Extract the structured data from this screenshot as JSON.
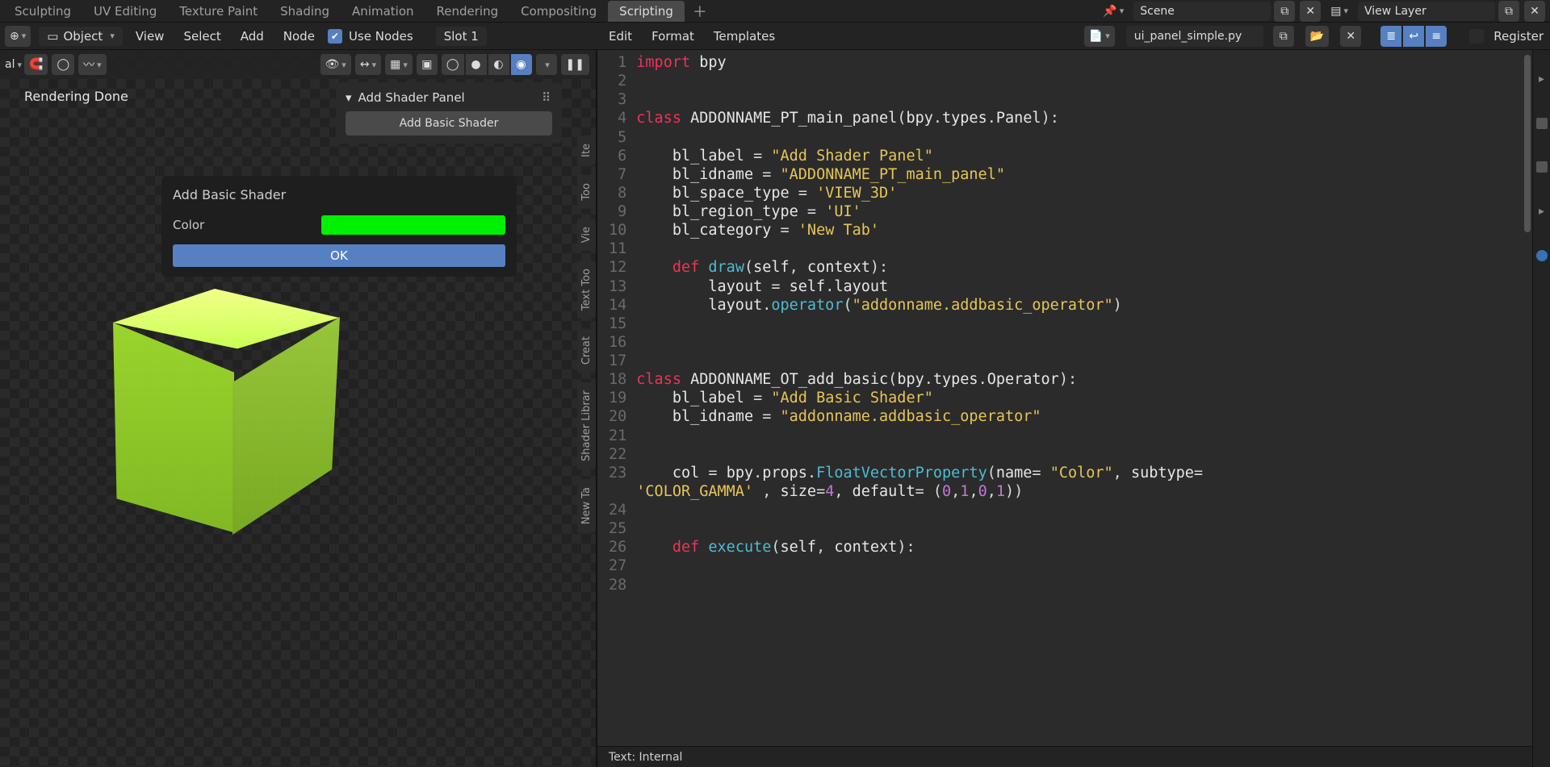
{
  "workspace_tabs": [
    "Sculpting",
    "UV Editing",
    "Texture Paint",
    "Shading",
    "Animation",
    "Rendering",
    "Compositing",
    "Scripting"
  ],
  "workspace_active": "Scripting",
  "scene_field": "Scene",
  "viewlayer_field": "View Layer",
  "node_header": {
    "mode_label": "Object",
    "menus": [
      "View",
      "Select",
      "Add",
      "Node"
    ],
    "use_nodes_label": "Use Nodes",
    "use_nodes_checked": true,
    "slot_label": "Slot 1"
  },
  "render_status": "Rendering Done",
  "side_tabs": [
    "Ite",
    "Too",
    "Vie",
    "Text Too",
    "Creat",
    "Shader Librar",
    "New Ta"
  ],
  "npanel": {
    "title": "Add Shader Panel",
    "button": "Add Basic Shader"
  },
  "op_popup": {
    "title": "Add Basic Shader",
    "color_label": "Color",
    "color_value": "#00f000",
    "ok_label": "OK"
  },
  "text_header": {
    "menus": [
      "Edit",
      "Format",
      "Templates"
    ],
    "filename": "ui_panel_simple.py",
    "register_label": "Register",
    "register_checked": false,
    "line_numbers_on": true,
    "wrap_on": true,
    "syntax_on": true
  },
  "code_lines": [
    {
      "n": 1,
      "t": [
        [
          "kw",
          "import"
        ],
        [
          "pn",
          " "
        ],
        [
          "var",
          "bpy"
        ]
      ]
    },
    {
      "n": 2,
      "t": []
    },
    {
      "n": 3,
      "t": []
    },
    {
      "n": 4,
      "t": [
        [
          "kw",
          "class"
        ],
        [
          "pn",
          " "
        ],
        [
          "var",
          "ADDONNAME_PT_main_panel"
        ],
        [
          "pn",
          "("
        ],
        [
          "var",
          "bpy"
        ],
        [
          "pn",
          "."
        ],
        [
          "var",
          "types"
        ],
        [
          "pn",
          "."
        ],
        [
          "var",
          "Panel"
        ],
        [
          "pn",
          "):"
        ]
      ]
    },
    {
      "n": 5,
      "t": []
    },
    {
      "n": 6,
      "t": [
        [
          "pn",
          "    "
        ],
        [
          "var",
          "bl_label"
        ],
        [
          "pn",
          " = "
        ],
        [
          "str",
          "\"Add Shader Panel\""
        ]
      ]
    },
    {
      "n": 7,
      "t": [
        [
          "pn",
          "    "
        ],
        [
          "var",
          "bl_idname"
        ],
        [
          "pn",
          " = "
        ],
        [
          "str",
          "\"ADDONNAME_PT_main_panel\""
        ]
      ]
    },
    {
      "n": 8,
      "t": [
        [
          "pn",
          "    "
        ],
        [
          "var",
          "bl_space_type"
        ],
        [
          "pn",
          " = "
        ],
        [
          "str",
          "'VIEW_3D'"
        ]
      ]
    },
    {
      "n": 9,
      "t": [
        [
          "pn",
          "    "
        ],
        [
          "var",
          "bl_region_type"
        ],
        [
          "pn",
          " = "
        ],
        [
          "str",
          "'UI'"
        ]
      ]
    },
    {
      "n": 10,
      "t": [
        [
          "pn",
          "    "
        ],
        [
          "var",
          "bl_category"
        ],
        [
          "pn",
          " = "
        ],
        [
          "str",
          "'New Tab'"
        ]
      ]
    },
    {
      "n": 11,
      "t": []
    },
    {
      "n": 12,
      "t": [
        [
          "pn",
          "    "
        ],
        [
          "kw",
          "def"
        ],
        [
          "pn",
          " "
        ],
        [
          "fn",
          "draw"
        ],
        [
          "pn",
          "("
        ],
        [
          "var",
          "self"
        ],
        [
          "pn",
          ", "
        ],
        [
          "var",
          "context"
        ],
        [
          "pn",
          "):"
        ]
      ]
    },
    {
      "n": 13,
      "t": [
        [
          "pn",
          "        "
        ],
        [
          "var",
          "layout"
        ],
        [
          "pn",
          " = "
        ],
        [
          "var",
          "self"
        ],
        [
          "pn",
          "."
        ],
        [
          "var",
          "layout"
        ]
      ]
    },
    {
      "n": 14,
      "t": [
        [
          "pn",
          "        "
        ],
        [
          "var",
          "layout"
        ],
        [
          "pn",
          "."
        ],
        [
          "fn",
          "operator"
        ],
        [
          "pn",
          "("
        ],
        [
          "str",
          "\"addonname.addbasic_operator\""
        ],
        [
          "pn",
          ")"
        ]
      ]
    },
    {
      "n": 15,
      "t": []
    },
    {
      "n": 16,
      "t": []
    },
    {
      "n": 17,
      "t": []
    },
    {
      "n": 18,
      "t": [
        [
          "kw",
          "class"
        ],
        [
          "pn",
          " "
        ],
        [
          "var",
          "ADDONNAME_OT_add_basic"
        ],
        [
          "pn",
          "("
        ],
        [
          "var",
          "bpy"
        ],
        [
          "pn",
          "."
        ],
        [
          "var",
          "types"
        ],
        [
          "pn",
          "."
        ],
        [
          "var",
          "Operator"
        ],
        [
          "pn",
          "):"
        ]
      ]
    },
    {
      "n": 19,
      "t": [
        [
          "pn",
          "    "
        ],
        [
          "var",
          "bl_label"
        ],
        [
          "pn",
          " = "
        ],
        [
          "str",
          "\"Add Basic Shader\""
        ]
      ]
    },
    {
      "n": 20,
      "t": [
        [
          "pn",
          "    "
        ],
        [
          "var",
          "bl_idname"
        ],
        [
          "pn",
          " = "
        ],
        [
          "str",
          "\"addonname.addbasic_operator\""
        ]
      ]
    },
    {
      "n": 21,
      "t": []
    },
    {
      "n": 22,
      "t": []
    },
    {
      "n": 23,
      "t": [
        [
          "pn",
          "    "
        ],
        [
          "var",
          "col"
        ],
        [
          "pn",
          " = "
        ],
        [
          "var",
          "bpy"
        ],
        [
          "pn",
          "."
        ],
        [
          "var",
          "props"
        ],
        [
          "pn",
          "."
        ],
        [
          "fn",
          "FloatVectorProperty"
        ],
        [
          "pn",
          "("
        ],
        [
          "var",
          "name"
        ],
        [
          "pn",
          "= "
        ],
        [
          "str",
          "\"Color\""
        ],
        [
          "pn",
          ", "
        ],
        [
          "var",
          "subtype"
        ],
        [
          "pn",
          "="
        ]
      ]
    },
    {
      "n": "",
      "t": [
        [
          "str",
          "'COLOR_GAMMA'"
        ],
        [
          "pn",
          " , "
        ],
        [
          "var",
          "size"
        ],
        [
          "pn",
          "="
        ],
        [
          "num",
          "4"
        ],
        [
          "pn",
          ", "
        ],
        [
          "var",
          "default"
        ],
        [
          "pn",
          "= ("
        ],
        [
          "num",
          "0"
        ],
        [
          "pn",
          ","
        ],
        [
          "num",
          "1"
        ],
        [
          "pn",
          ","
        ],
        [
          "num",
          "0"
        ],
        [
          "pn",
          ","
        ],
        [
          "num",
          "1"
        ],
        [
          "pn",
          "))"
        ]
      ]
    },
    {
      "n": 24,
      "t": []
    },
    {
      "n": 25,
      "t": []
    },
    {
      "n": 26,
      "t": [
        [
          "pn",
          "    "
        ],
        [
          "kw",
          "def"
        ],
        [
          "pn",
          " "
        ],
        [
          "fn",
          "execute"
        ],
        [
          "pn",
          "("
        ],
        [
          "var",
          "self"
        ],
        [
          "pn",
          ", "
        ],
        [
          "var",
          "context"
        ],
        [
          "pn",
          "):"
        ]
      ]
    },
    {
      "n": 27,
      "t": []
    },
    {
      "n": 28,
      "t": []
    }
  ],
  "text_footer": "Text: Internal",
  "icons": {
    "cursor": "⊕",
    "object": "▭",
    "chevron": "▾",
    "link": "🔗",
    "pin": "📌",
    "eye": "👁",
    "arrows": "↔",
    "shading_sphere": "●",
    "wire_sphere": "◯",
    "matcap": "◐",
    "rendered": "◉",
    "pause": "❚❚",
    "overlay": "▦",
    "xray": "▣",
    "camera": "🎥",
    "browse": "📄",
    "open": "📂",
    "close": "✕",
    "linenum": "≣",
    "wrap": "↩",
    "syntax": "≡",
    "copy": "⧉",
    "layers": "▤",
    "chev_r": "▸"
  }
}
